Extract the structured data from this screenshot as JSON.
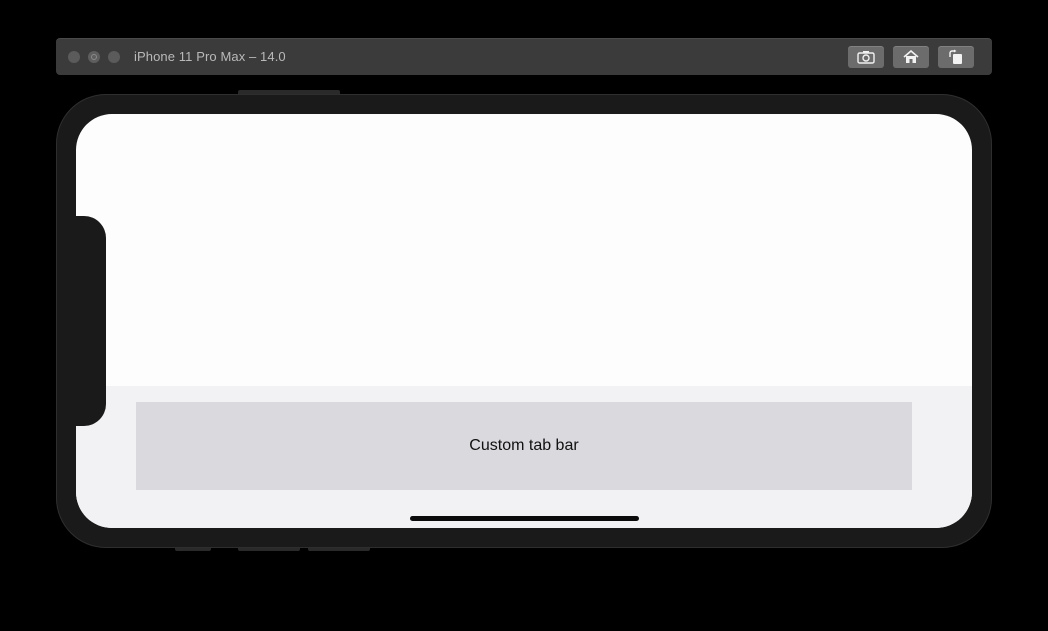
{
  "window": {
    "title": "iPhone 11 Pro Max – 14.0",
    "controls": [
      "close",
      "minimize",
      "zoom"
    ],
    "toolbar": [
      {
        "name": "screenshot",
        "icon": "camera-icon"
      },
      {
        "name": "home",
        "icon": "home-icon"
      },
      {
        "name": "rotate",
        "icon": "rotate-icon"
      }
    ]
  },
  "app": {
    "tab_bar": {
      "label": "Custom tab bar"
    }
  },
  "colors": {
    "device_bezel": "#1a1a1a",
    "screen_background": "#fdfdfe",
    "tab_bar_background": "#d9d9de",
    "bottom_area_background": "#f2f2f4"
  }
}
